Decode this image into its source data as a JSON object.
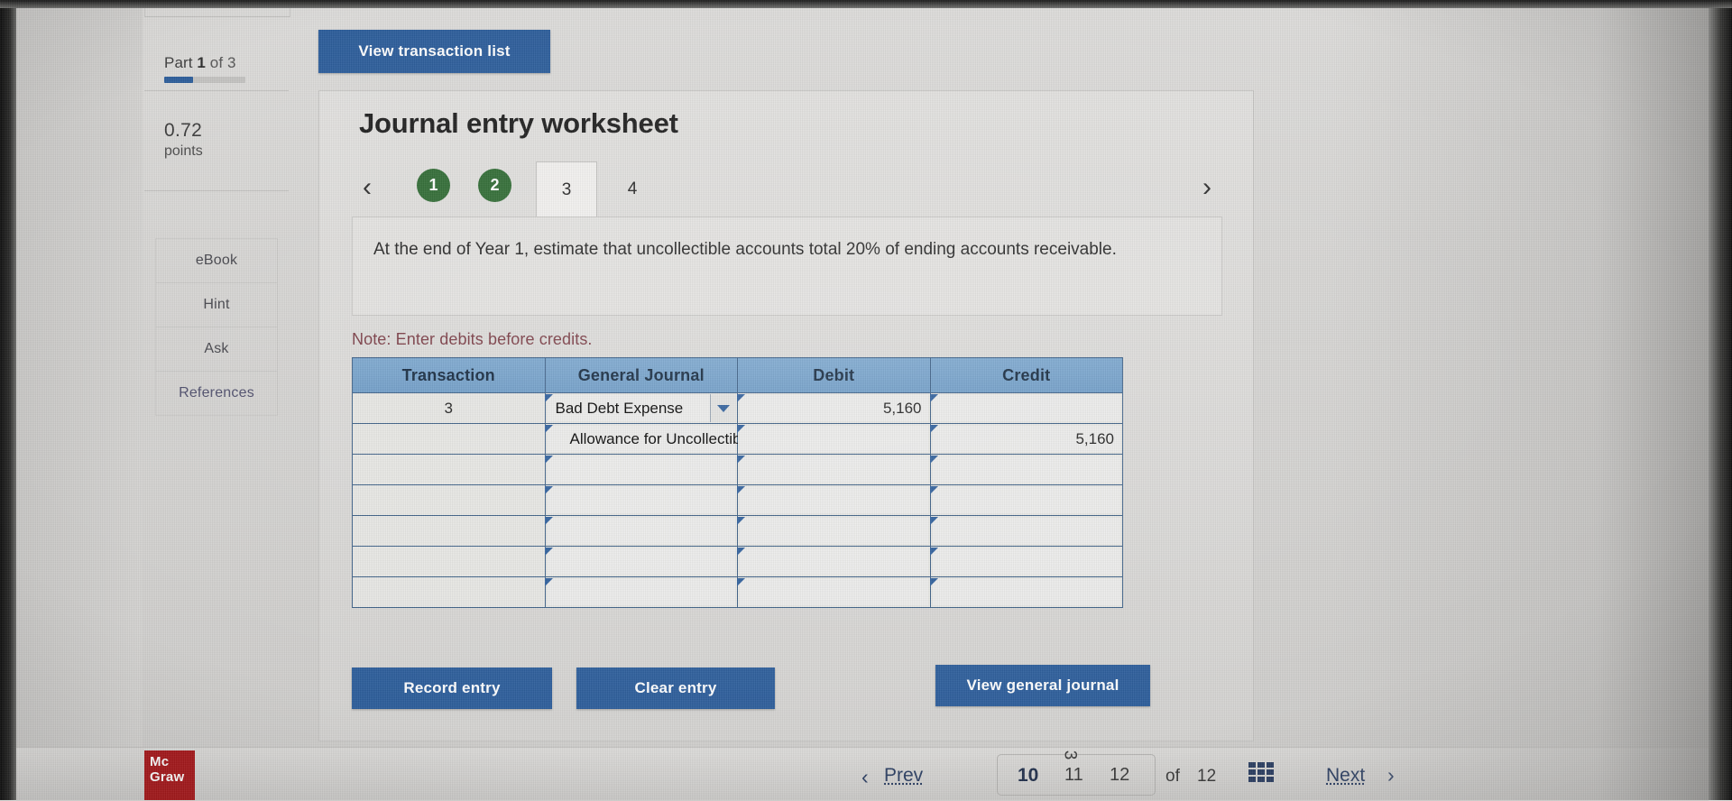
{
  "sidebar": {
    "part_prefix": "Part",
    "part_current": "1",
    "part_of": "of 3",
    "points_value": "0.72",
    "points_unit": "points",
    "buttons": [
      {
        "label": "eBook"
      },
      {
        "label": "Hint"
      },
      {
        "label": "Ask"
      },
      {
        "label": "References"
      }
    ]
  },
  "toolbar": {
    "view_transaction_list": "View transaction list"
  },
  "worksheet": {
    "title": "Journal entry worksheet",
    "tabs": [
      {
        "label": "1",
        "state": "completed"
      },
      {
        "label": "2",
        "state": "completed"
      },
      {
        "label": "3",
        "state": "active"
      },
      {
        "label": "4",
        "state": "pending"
      }
    ],
    "prev_arrow": "‹",
    "next_arrow": "›",
    "instruction": "At the end of Year 1, estimate that uncollectible accounts total 20% of ending accounts receivable.",
    "note": "Note: Enter debits before credits."
  },
  "table": {
    "headers": [
      "Transaction",
      "General Journal",
      "Debit",
      "Credit"
    ],
    "rows": [
      {
        "transaction": "3",
        "general_journal": "Bad Debt Expense",
        "debit": "5,160",
        "credit": "",
        "has_dropdown": true,
        "indent": false
      },
      {
        "transaction": "",
        "general_journal": "Allowance for Uncollectible Accounts",
        "debit": "",
        "credit": "5,160",
        "has_dropdown": false,
        "indent": true
      },
      {
        "transaction": "",
        "general_journal": "",
        "debit": "",
        "credit": "",
        "has_dropdown": false,
        "indent": false
      },
      {
        "transaction": "",
        "general_journal": "",
        "debit": "",
        "credit": "",
        "has_dropdown": false,
        "indent": false
      },
      {
        "transaction": "",
        "general_journal": "",
        "debit": "",
        "credit": "",
        "has_dropdown": false,
        "indent": false
      },
      {
        "transaction": "",
        "general_journal": "",
        "debit": "",
        "credit": "",
        "has_dropdown": false,
        "indent": false
      },
      {
        "transaction": "",
        "general_journal": "",
        "debit": "",
        "credit": "",
        "has_dropdown": false,
        "indent": false
      }
    ]
  },
  "actions": {
    "record_entry": "Record entry",
    "clear_entry": "Clear entry",
    "view_general_journal": "View general journal"
  },
  "footer": {
    "logo_line1": "Mc",
    "logo_line2": "Graw",
    "prev_label": "Prev",
    "prev_chevron": "‹",
    "pages": [
      "10",
      "11",
      "12"
    ],
    "page_marker": "3",
    "of_label": "of",
    "total_pages": "12",
    "next_label": "Next",
    "next_chevron": "›",
    "grid_icon": "grid-icon"
  },
  "colors": {
    "primary_blue": "#2c5d9b",
    "tab_green": "#2f6b33",
    "table_header": "#7ba7cf",
    "note_red": "#7a3b44",
    "logo_red": "#a8191c"
  }
}
